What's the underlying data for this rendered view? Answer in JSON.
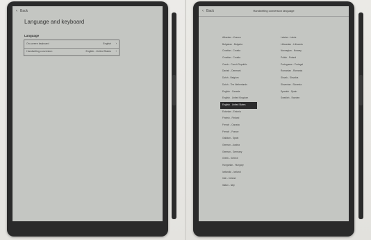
{
  "left_screen": {
    "back_label": "Back",
    "title": "Language and keyboard",
    "section_label": "Language",
    "rows": [
      {
        "label": "On-screen keyboard",
        "value": "English"
      },
      {
        "label": "Handwriting conversion",
        "value": "English - United States"
      }
    ]
  },
  "right_screen": {
    "back_label": "Back",
    "title": "Handwriting conversion language",
    "selected_index": 10,
    "column1": [
      "Albanian - Kosovo",
      "Bulgarian - Bulgaria",
      "Croatian - Croatia",
      "Croatian - Croatia",
      "Czech - Czech Republic",
      "Danish - Denmark",
      "Dutch - Belgium",
      "Dutch - The Netherlands",
      "English - Canada",
      "English - United Kingdom",
      "English - United States",
      "Estonian - Estonia",
      "Finnish - Finland",
      "French - Canada",
      "French - France",
      "Galician - Spain",
      "German - Austria",
      "German - Germany",
      "Greek - Greece",
      "Hungarian - Hungary",
      "Icelandic - Iceland",
      "Irish - Ireland",
      "Italian - Italy"
    ],
    "column2": [
      "Latvian - Latvia",
      "Lithuanian - Lithuania",
      "Norwegian - Norway",
      "Polish - Poland",
      "Portuguese - Portugal",
      "Romanian - Romania",
      "Slovak - Slovakia",
      "Slovenian - Slovenia",
      "Spanish - Spain",
      "Swedish - Sweden"
    ]
  }
}
